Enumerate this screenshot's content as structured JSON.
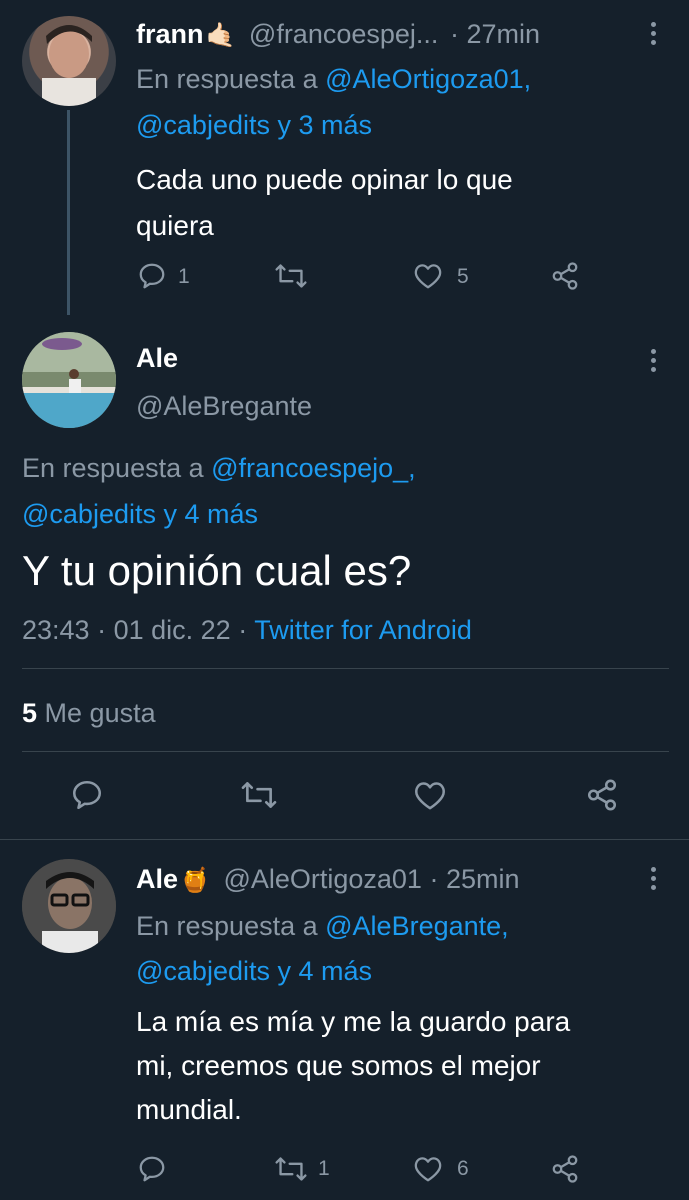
{
  "colors": {
    "background": "#15202b",
    "text": "#ffffff",
    "muted": "#8b98a5",
    "link": "#1d9bf0",
    "divider": "#38444d"
  },
  "reply1": {
    "name": "frann",
    "emoji": "🤙🏻",
    "handle": "@francoespej...",
    "sep": "·",
    "time": "27min",
    "replying_prefix": "En respuesta a",
    "replying_mention": "@AleOrtigoza01,",
    "replying_line2_mention": "@cabjedits",
    "replying_line2_suffix": "y 3 más",
    "text_line1": "Cada uno puede opinar lo que",
    "text_line2": "quiera",
    "reply_count": "1",
    "like_count": "5",
    "icons": [
      "reply-icon",
      "retweet-icon",
      "like-icon",
      "share-icon",
      "more-icon"
    ]
  },
  "main": {
    "name": "Ale",
    "handle": "@AleBregante",
    "replying_prefix": "En respuesta a",
    "replying_mention": "@francoespejo_,",
    "replying_line2_mention": "@cabjedits",
    "replying_line2_suffix": "y 4 más",
    "text": "Y tu opinión cual es?",
    "time": "23:43",
    "date": "01 dic. 22",
    "source": "Twitter for Android",
    "sep": "·",
    "likes_number": "5",
    "likes_label": "Me gusta"
  },
  "reply2": {
    "name": "Ale",
    "emoji": "🍯",
    "handle": "@AleOrtigoza01",
    "sep": "·",
    "time": "25min",
    "replying_prefix": "En respuesta a",
    "replying_mention": "@AleBregante,",
    "replying_line2_mention": "@cabjedits",
    "replying_line2_suffix": "y 4 más",
    "text_line1": "La mía es mía y me la guardo para",
    "text_line2": "mi, creemos que somos el mejor",
    "text_line3": "mundial.",
    "retweet_count": "1",
    "like_count": "6"
  }
}
